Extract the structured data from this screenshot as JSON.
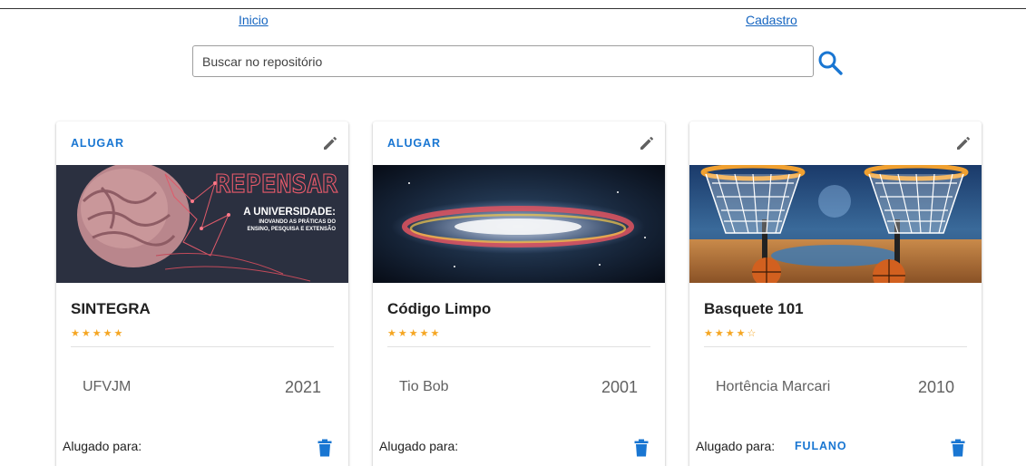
{
  "nav": {
    "home_label": "Inicio",
    "register_label": "Cadastro"
  },
  "search": {
    "placeholder": "Buscar no repositório",
    "icon": "search-icon"
  },
  "colors": {
    "link": "#1565c0",
    "accent": "#1976d2",
    "star": "#f5a623",
    "text": "#212121",
    "muted": "#616161"
  },
  "cards": [
    {
      "action_label": "ALUGAR",
      "edit_icon": "pencil-icon",
      "image": "repensar-brain-banner",
      "image_text": {
        "title": "REPENSAR",
        "line1": "A UNIVERSIDADE:",
        "line2": "INOVANDO AS PRÁTICAS DO",
        "line3": "ENSINO, PESQUISA E EXTENSÃO"
      },
      "title": "SINTEGRA",
      "rating": 5,
      "stars_display": "★★★★★",
      "author": "UFVJM",
      "year": "2021",
      "rented_label": "Alugado para:",
      "rented_to": "",
      "delete_icon": "trash-icon"
    },
    {
      "action_label": "ALUGAR",
      "edit_icon": "pencil-icon",
      "image": "galaxy-image",
      "title": "Código Limpo",
      "rating": 5,
      "stars_display": "★★★★★",
      "author": "Tio Bob",
      "year": "2001",
      "rented_label": "Alugado para:",
      "rented_to": "",
      "delete_icon": "trash-icon"
    },
    {
      "action_label": "",
      "edit_icon": "pencil-icon",
      "image": "basketball-hoops-image",
      "title": "Basquete 101",
      "rating": 4,
      "stars_display": "★★★★☆",
      "author": "Hortência Marcari",
      "year": "2010",
      "rented_label": "Alugado para:",
      "rented_to": "FULANO",
      "delete_icon": "trash-icon"
    }
  ]
}
